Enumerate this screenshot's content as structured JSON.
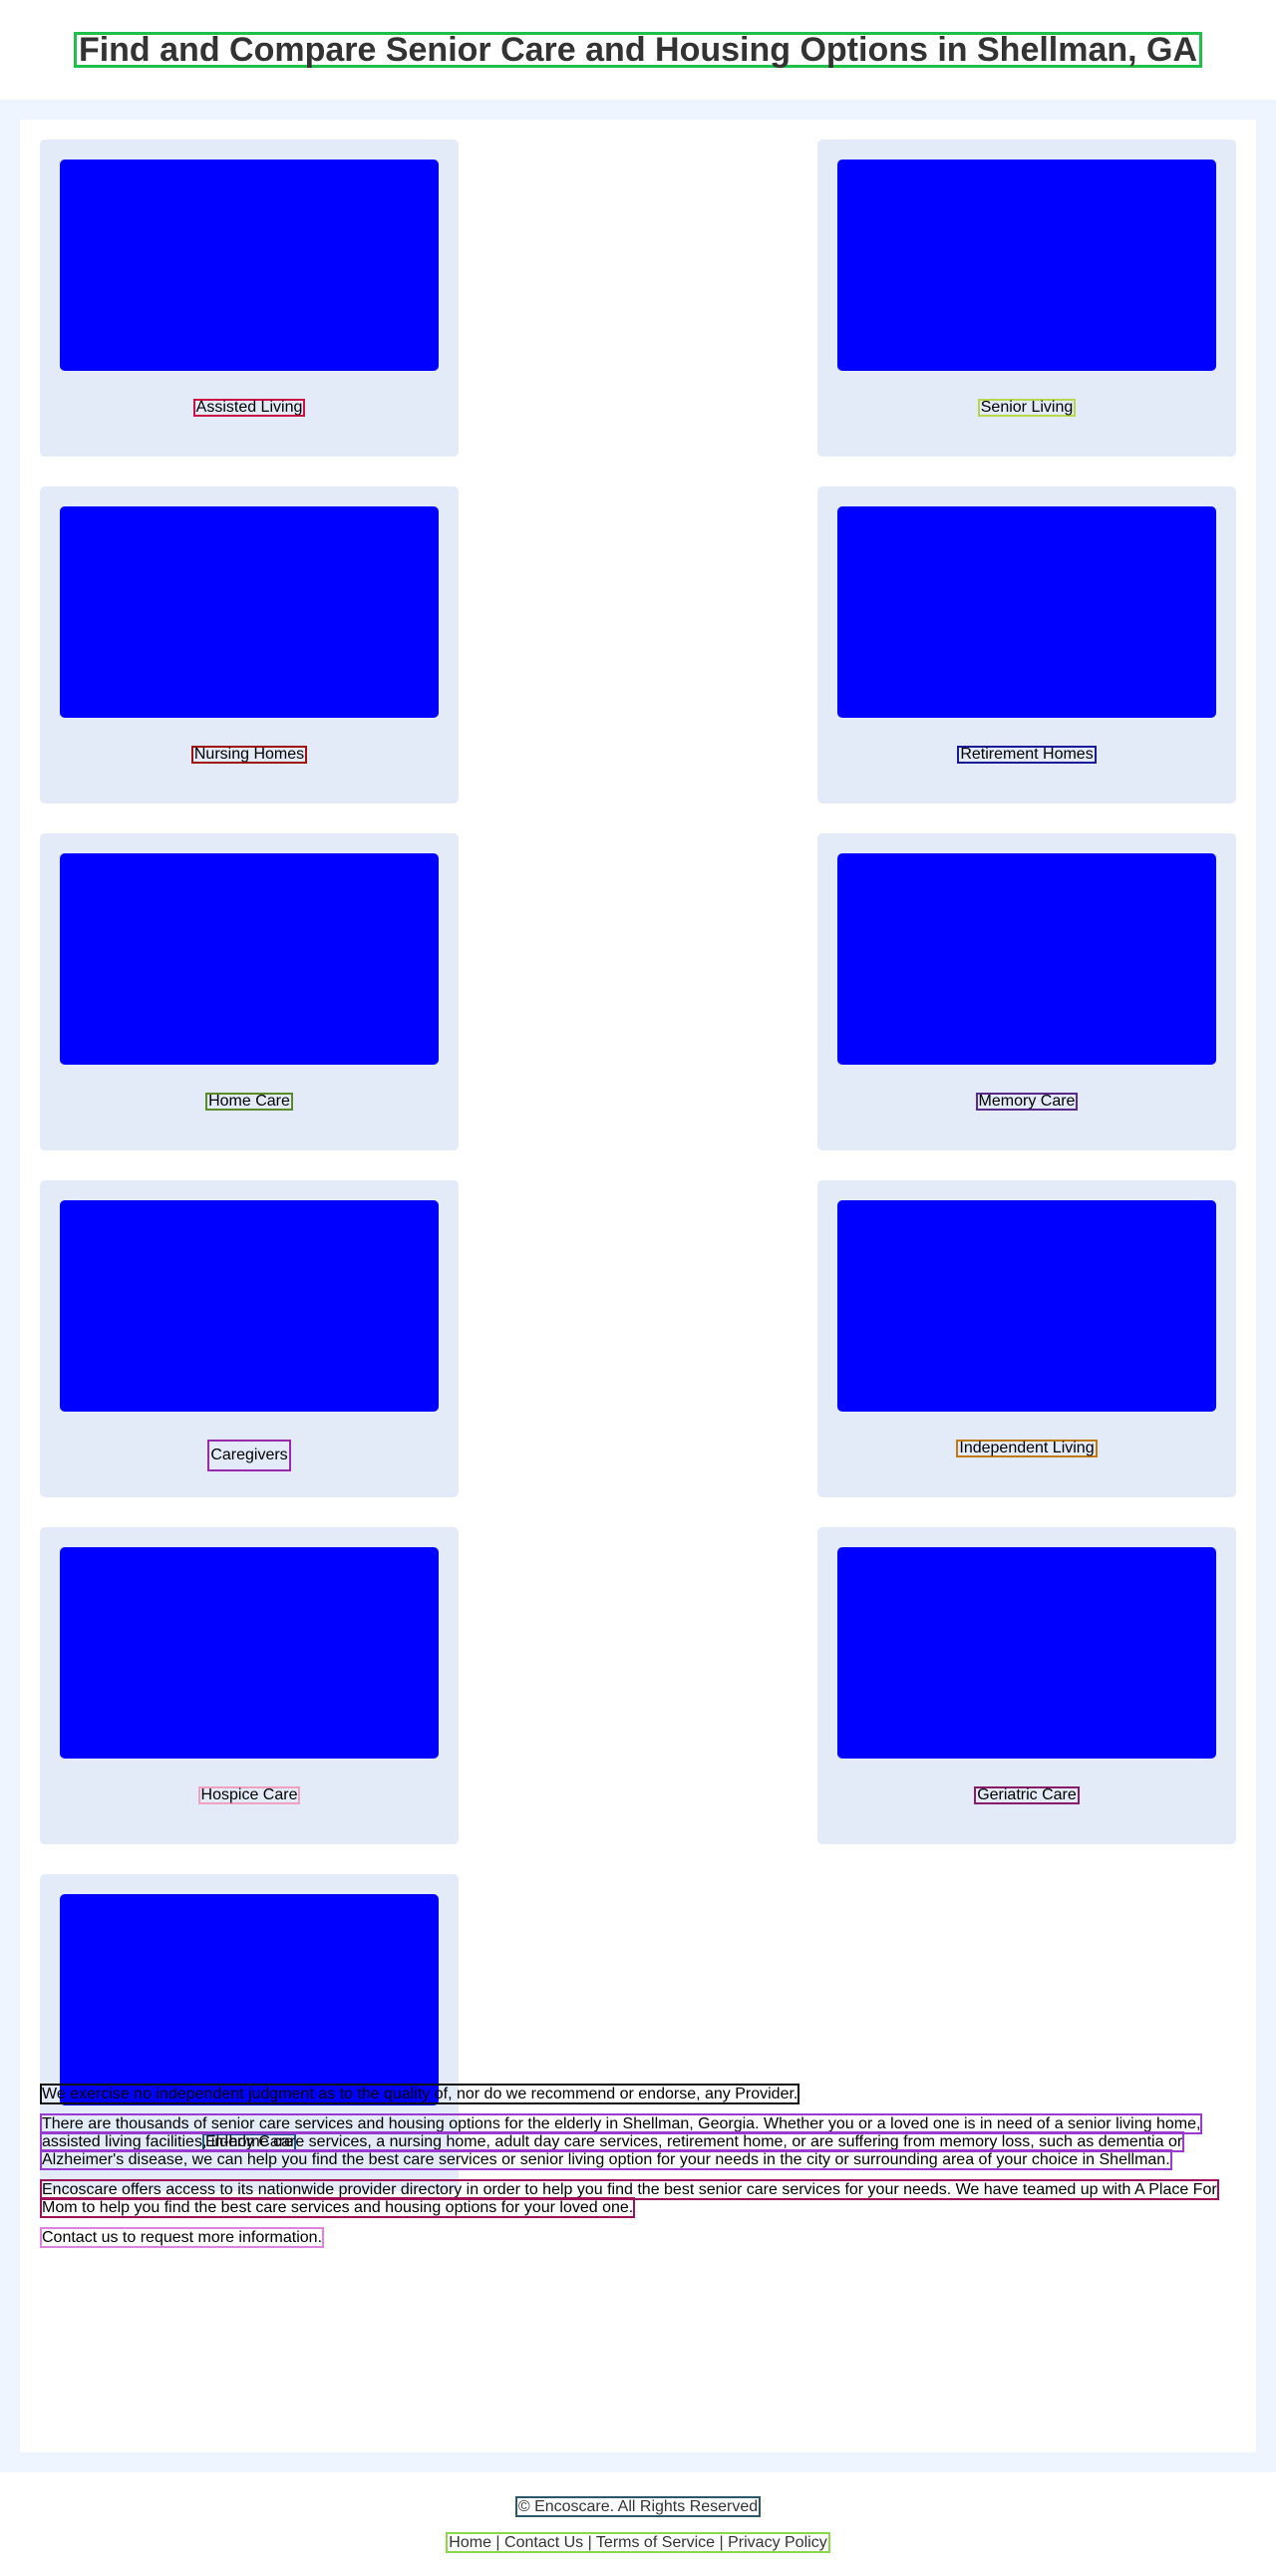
{
  "header": {
    "title": "Find and Compare Senior Care and Housing Options in Shellman, GA"
  },
  "cards": [
    {
      "label": "Assisted Living",
      "border": "#cc1144"
    },
    {
      "label": "Senior Living",
      "border": "#b6d84a"
    },
    {
      "label": "Nursing Homes",
      "border": "#a01010"
    },
    {
      "label": "Retirement Homes",
      "border": "#1a1a9a"
    },
    {
      "label": "Home Care",
      "border": "#5a8a2a"
    },
    {
      "label": "Memory Care",
      "border": "#5a2a8a"
    },
    {
      "label": "Caregivers",
      "border": "#9a2ab0"
    },
    {
      "label": "Independent Living",
      "border": "#c07a10"
    },
    {
      "label": "Hospice Care",
      "border": "#f2a0c0"
    },
    {
      "label": "Geriatric Care",
      "border": "#8a1a6a"
    },
    {
      "label": "Elderly Care",
      "border": "#1a5a9a"
    }
  ],
  "info": {
    "disclaimer": "We exercise no independent judgment as to the quality of, nor do we recommend or endorse, any Provider.",
    "intro": "There are thousands of senior care services and housing options for the elderly in Shellman, Georgia. Whether you or a loved one is in need of a senior living home, assisted living facilities, in-home care services, a nursing home, adult day care services, retirement home, or are suffering from memory loss, such as dementia or Alzheimer's disease, we can help you find the best care services or senior living option for your needs in the city or surrounding area of your choice in Shellman.",
    "offers": "Encoscare offers access to its nationwide provider directory in order to help you find the best senior care services for your needs. We have teamed up with A Place For Mom to help you find the best care services and housing options for your loved one.",
    "contact": "Contact us to request more information."
  },
  "footer": {
    "copyright": "© Encoscare. All Rights Reserved",
    "links": "Home | Contact Us | Terms of Service | Privacy Policy"
  }
}
